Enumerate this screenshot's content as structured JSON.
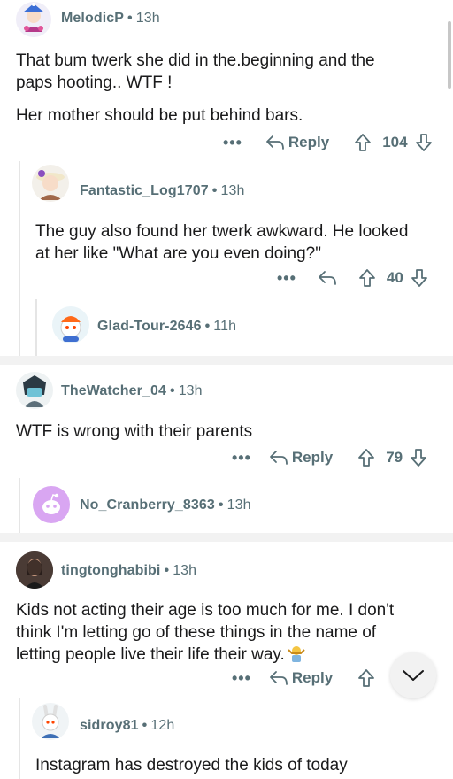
{
  "comments": [
    {
      "username": "MelodicP",
      "time": "13h",
      "body_lines": [
        "That bum twerk she did in the.beginning and the",
        "paps hooting.. WTF !"
      ],
      "body_line2": "Her mother should be put behind bars.",
      "more": "•••",
      "reply": "Reply",
      "votes": "104"
    },
    {
      "username": "Fantastic_Log1707",
      "time": "13h",
      "body_lines": [
        "The guy also found her twerk awkward. He looked",
        "at her like \"What are you even doing?\""
      ],
      "more": "•••",
      "votes": "40"
    },
    {
      "username": "Glad-Tour-2646",
      "time": "11h"
    },
    {
      "username": "TheWatcher_04",
      "time": "13h",
      "body_lines": [
        "WTF is wrong with their parents"
      ],
      "more": "•••",
      "reply": "Reply",
      "votes": "79"
    },
    {
      "username": "No_Cranberry_8363",
      "time": "13h"
    },
    {
      "username": "tingtonghabibi",
      "time": "13h",
      "body_lines": [
        "Kids not acting their age is too much for me. I don't",
        "think I'm letting go of these things in the name of",
        "letting people live their life their way."
      ],
      "more": "•••",
      "reply": "Reply",
      "votes": ""
    },
    {
      "username": "sidroy81",
      "time": "12h",
      "body_lines": [
        "Instagram has destroyed the kids of today"
      ]
    }
  ],
  "dot": "•",
  "colors": {
    "text": "#1a1a1b",
    "meta": "#576f76",
    "divider": "#f2f2f2"
  }
}
